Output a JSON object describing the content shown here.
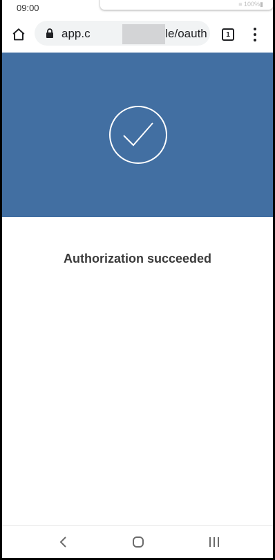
{
  "theme": {
    "hero_color": "#426fa2",
    "text_color": "#3b3b3b"
  },
  "status_bar": {
    "time": "09:00",
    "notification_status_text": "≡ 100%▮"
  },
  "browser": {
    "url_text": "app.c            e/google/oauth",
    "tab_count": "1",
    "icons": [
      "home-icon",
      "lock-icon",
      "tab-switcher-icon",
      "more-vert-icon"
    ]
  },
  "content": {
    "icon": "check-circle-icon",
    "title": "Authorization succeeded"
  },
  "nav_bar": {
    "icons": [
      "back-icon",
      "home-icon",
      "recents-icon"
    ]
  }
}
